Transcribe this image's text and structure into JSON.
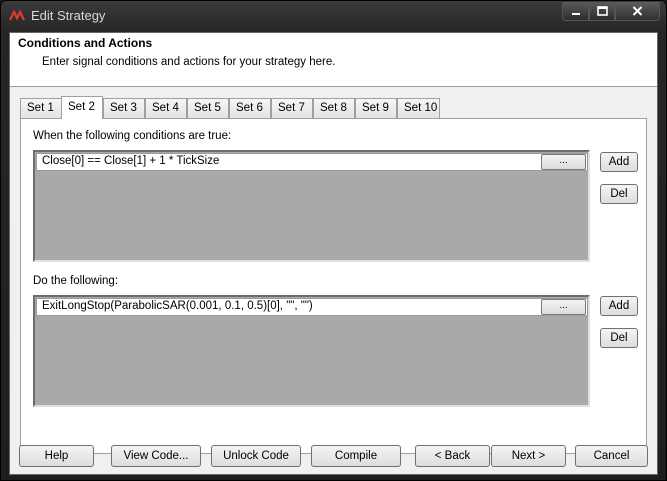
{
  "window": {
    "title": "Edit Strategy",
    "controls": {
      "minimize": "minimize",
      "maximize": "maximize",
      "close": "close"
    }
  },
  "header": {
    "title": "Conditions and Actions",
    "subtitle": "Enter signal conditions and actions for your strategy here."
  },
  "tabs": [
    {
      "label": "Set 1",
      "active": false
    },
    {
      "label": "Set 2",
      "active": true
    },
    {
      "label": "Set 3",
      "active": false
    },
    {
      "label": "Set 4",
      "active": false
    },
    {
      "label": "Set 5",
      "active": false
    },
    {
      "label": "Set 6",
      "active": false
    },
    {
      "label": "Set 7",
      "active": false
    },
    {
      "label": "Set 8",
      "active": false
    },
    {
      "label": "Set 9",
      "active": false
    },
    {
      "label": "Set 10",
      "active": false
    }
  ],
  "conditions": {
    "label": "When the following conditions are true:",
    "items": [
      "Close[0] == Close[1] + 1 * TickSize"
    ],
    "ellipsis_label": "...",
    "add_label": "Add",
    "del_label": "Del"
  },
  "actions": {
    "label": "Do the following:",
    "items": [
      "ExitLongStop(ParabolicSAR(0.001, 0.1, 0.5)[0], \"\", \"\")"
    ],
    "ellipsis_label": "...",
    "add_label": "Add",
    "del_label": "Del"
  },
  "footer": {
    "help": "Help",
    "view_code": "View Code...",
    "unlock_code": "Unlock Code",
    "compile": "Compile",
    "back": "< Back",
    "next": "Next >",
    "cancel": "Cancel"
  },
  "colors": {
    "list_background": "#a9a9a9",
    "dialog_background": "#f0f0f0",
    "titlebar": "#262626"
  }
}
